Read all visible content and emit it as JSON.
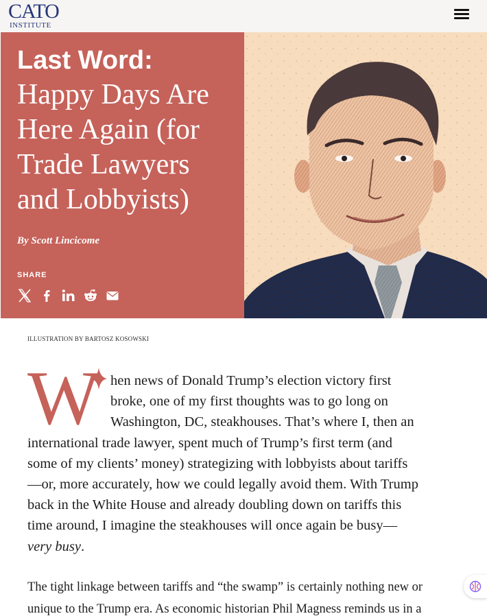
{
  "header": {
    "logo_top": "CATO",
    "logo_bottom": "INSTITUTE"
  },
  "hero": {
    "kicker": "Last Word:",
    "title": "Happy Days Are Here Again (for Trade Lawyers and Lobbyists)",
    "byline_prefix": "By",
    "author": "Scott Lincicome",
    "share_label": "SHARE",
    "share_icons": [
      "x-icon",
      "facebook-icon",
      "linkedin-icon",
      "reddit-icon",
      "email-icon"
    ],
    "accent_color": "#c5625a",
    "illustration_bg": "#f7dcbd"
  },
  "article": {
    "caption": "ILLUSTRATION BY BARTOSZ KOSOWSKI",
    "dropcap": "W",
    "para1_lines": [
      "hen news of Donald Trump’s election victory first",
      "broke, one of my first thoughts was to go long on",
      "Washington, DC, steakhouses. That’s where I, then an",
      "international trade lawyer, spent much of Trump’s first term (and",
      "some of my clients’ money) strategizing with lobbyists about tariffs",
      "—or, more accurately, how we could legally avoid them. With Trump",
      "back in the White House and already doubling down on tariffs this",
      "time around, I imagine the steakhouses will once again be busy—"
    ],
    "para1_emph": "very busy",
    "para1_end": ".",
    "para2_lines": [
      "The tight linkage between tariffs and “the swamp” is certainly nothing new or",
      "unique to the Trump era. As economic historian Phil Magness reminds us in a"
    ]
  }
}
